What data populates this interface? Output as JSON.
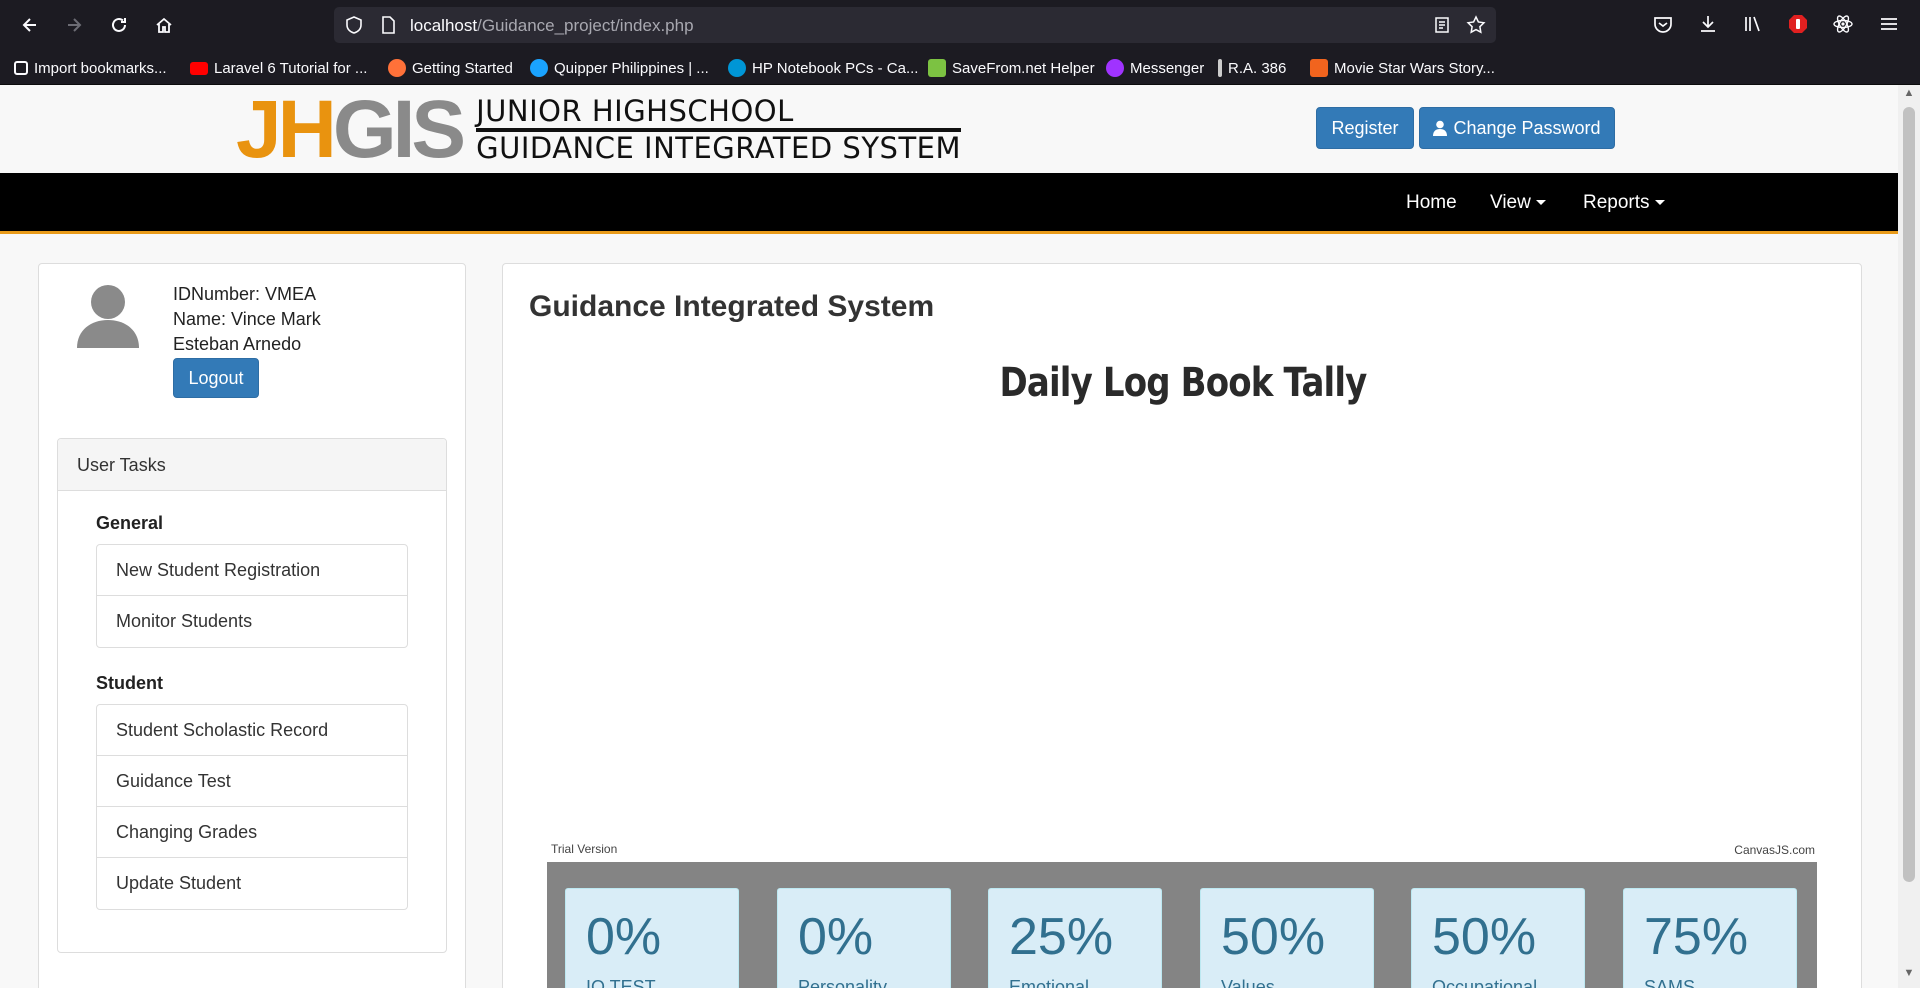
{
  "browser": {
    "url_host": "localhost",
    "url_path": "/Guidance_project/index.php",
    "bookmarks": [
      {
        "label": "Import bookmarks...",
        "icon": "import-icon",
        "color": "#fbfbfe"
      },
      {
        "label": "Laravel 6 Tutorial for ...",
        "icon": "youtube-icon",
        "color": "#ff0000"
      },
      {
        "label": "Getting Started",
        "icon": "firefox-icon",
        "color": "#ff7139"
      },
      {
        "label": "Quipper Philippines | ...",
        "icon": "quipper-icon",
        "color": "#1aa3ff"
      },
      {
        "label": "HP Notebook PCs - Ca...",
        "icon": "hp-icon",
        "color": "#0096d6"
      },
      {
        "label": "SaveFrom.net Helper",
        "icon": "download-arrow-icon",
        "color": "#7cc242"
      },
      {
        "label": "Messenger",
        "icon": "messenger-icon",
        "color": "#a033ff"
      },
      {
        "label": "R.A. 386",
        "icon": "text-cursor-icon",
        "color": "#cccccc"
      },
      {
        "label": "Movie Star Wars Story...",
        "icon": "etsy-icon",
        "color": "#f1641e"
      }
    ]
  },
  "header": {
    "logo_letters": [
      "J",
      "H",
      "G",
      "I",
      "S"
    ],
    "logo_line1": "JUNIOR HIGHSCHOOL",
    "logo_line2": "GUIDANCE INTEGRATED SYSTEM",
    "register_label": "Register",
    "change_password_label": "Change Password"
  },
  "nav": {
    "home": "Home",
    "view": "View",
    "reports": "Reports"
  },
  "user": {
    "id_line": "IDNumber: VMEA",
    "name_line1": "Name: Vince Mark",
    "name_line2": "Esteban Arnedo",
    "logout_label": "Logout"
  },
  "tasks": {
    "title": "User Tasks",
    "groups": [
      {
        "title": "General",
        "items": [
          "New Student Registration",
          "Monitor Students"
        ]
      },
      {
        "title": "Student",
        "items": [
          "Student Scholastic Record",
          "Guidance Test",
          "Changing Grades",
          "Update Student"
        ]
      }
    ]
  },
  "main": {
    "title": "Guidance Integrated System",
    "chart_title": "Daily Log Book Tally",
    "trial_text": "Trial Version",
    "credit_text": "CanvasJS.com",
    "stats": [
      {
        "value": "0%",
        "label": "IQ TEST"
      },
      {
        "value": "0%",
        "label": "Personality"
      },
      {
        "value": "25%",
        "label": "Emotional"
      },
      {
        "value": "50%",
        "label": "Values"
      },
      {
        "value": "50%",
        "label": "Occupational"
      },
      {
        "value": "75%",
        "label": "SAMS"
      }
    ]
  },
  "colors": {
    "primary": "#337ab7",
    "navbar": "#000000",
    "accent": "#e99b1a",
    "stat_card": "#d9edf7",
    "stat_text": "#31708f"
  }
}
